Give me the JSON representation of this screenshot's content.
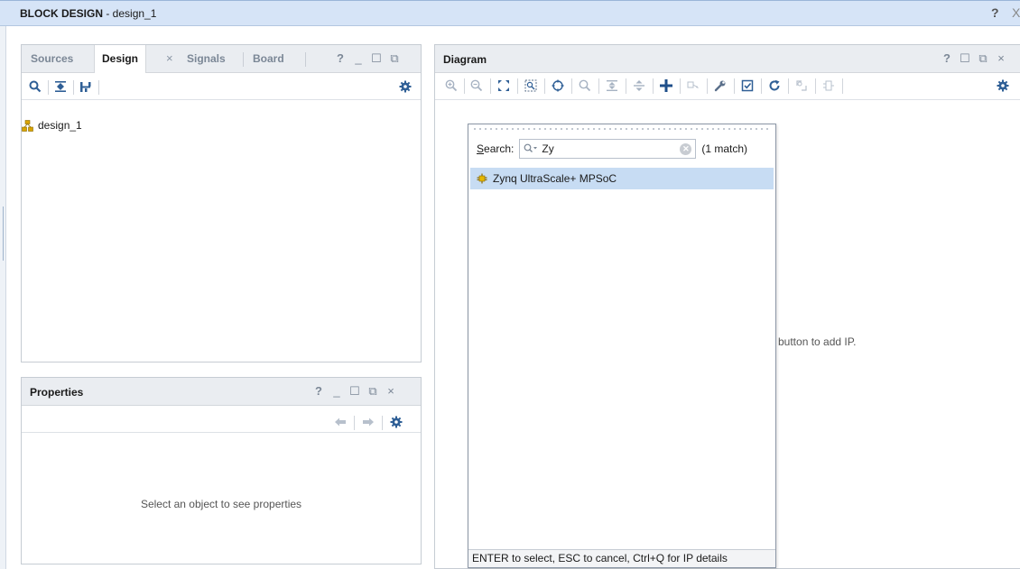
{
  "window": {
    "title_bold": "BLOCK DESIGN",
    "title_rest": " - design_1",
    "help": "?",
    "close_fragment": "X"
  },
  "left_panel": {
    "tabs": [
      {
        "label": "Sources",
        "active": false
      },
      {
        "label": "Design",
        "active": true
      },
      {
        "label": "Signals",
        "active": false
      },
      {
        "label": "Board",
        "active": false
      }
    ],
    "tab_close": "×",
    "window_buttons": [
      "?",
      "_",
      "☐",
      "⧉"
    ],
    "toolbar": [
      "search-icon",
      "collapse-all-icon",
      "hierarchy-icon",
      "gear-icon"
    ],
    "tree": [
      {
        "label": "design_1",
        "icon": "block-design-icon"
      }
    ]
  },
  "properties_panel": {
    "title": "Properties",
    "window_buttons": [
      "?",
      "_",
      "☐",
      "⧉",
      "×"
    ],
    "toolbar": [
      "back-arrow-icon",
      "forward-arrow-icon",
      "gear-icon"
    ],
    "empty_message": "Select an object to see properties"
  },
  "diagram_panel": {
    "title": "Diagram",
    "window_buttons": [
      "?",
      "☐",
      "⧉",
      "×"
    ],
    "toolbar": [
      "zoom-in-icon",
      "zoom-out-icon",
      "zoom-fit-icon",
      "zoom-area-icon",
      "selection-icon",
      "search-icon",
      "collapse-icon",
      "expand-icon",
      "add-ip-icon",
      "make-external-icon",
      "wrench-icon",
      "validate-icon",
      "refresh-icon",
      "regenerate-icon",
      "pin-icon",
      "gear-icon"
    ],
    "hint_text": "button to add IP."
  },
  "ip_search_popup": {
    "search_label_accel": "S",
    "search_label_rest": "earch:",
    "search_value": "Zy",
    "match_count": "(1 match)",
    "results": [
      {
        "label": "Zynq UltraScale+ MPSoC",
        "icon": "ip-core-icon",
        "selected": true
      }
    ],
    "footer": "ENTER to select, ESC to cancel, Ctrl+Q for IP details"
  },
  "colors": {
    "title_bar": "#d6e4f7",
    "panel_header": "#eaedf1",
    "selection": "#c7dcf3",
    "icon_blue": "#2f5f96",
    "add_blue": "#1f4f8a"
  }
}
